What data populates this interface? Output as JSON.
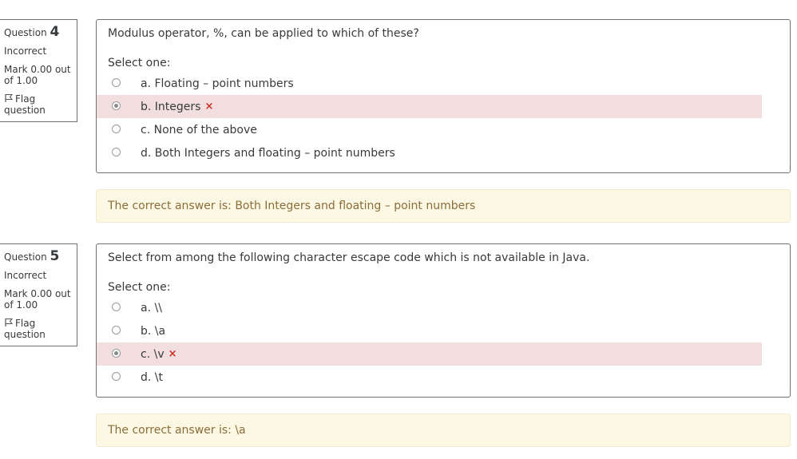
{
  "questions": [
    {
      "label": "Question",
      "number": "4",
      "state": "Incorrect",
      "grade": "Mark 0.00 out of 1.00",
      "flag_label": "Flag question",
      "text": "Modulus operator, %, can be applied to which of these?",
      "prompt": "Select one:",
      "options": [
        {
          "label": "a. Floating – point numbers",
          "checked": false,
          "incorrect": false
        },
        {
          "label": "b. Integers",
          "checked": true,
          "incorrect": true
        },
        {
          "label": "c. None of the above",
          "checked": false,
          "incorrect": false
        },
        {
          "label": "d. Both Integers and floating – point numbers",
          "checked": false,
          "incorrect": false
        }
      ],
      "feedback": "The correct answer is: Both Integers and floating – point numbers"
    },
    {
      "label": "Question",
      "number": "5",
      "state": "Incorrect",
      "grade": "Mark 0.00 out of 1.00",
      "flag_label": "Flag question",
      "text": "Select from among the following character escape code which is not available in Java.",
      "prompt": "Select one:",
      "options": [
        {
          "label": "a. \\\\",
          "checked": false,
          "incorrect": false
        },
        {
          "label": "b. \\a",
          "checked": false,
          "incorrect": false
        },
        {
          "label": "c. \\v",
          "checked": true,
          "incorrect": true
        },
        {
          "label": "d. \\t",
          "checked": false,
          "incorrect": false
        }
      ],
      "feedback": "The correct answer is: \\a"
    }
  ],
  "icons": {
    "incorrect_mark": "×",
    "flag": "flag-icon"
  },
  "colors": {
    "incorrect_bg": "#f2dedf",
    "incorrect_mark": "#ca3120",
    "feedback_bg": "#fcf8e3",
    "feedback_text": "#8a6d3b"
  }
}
